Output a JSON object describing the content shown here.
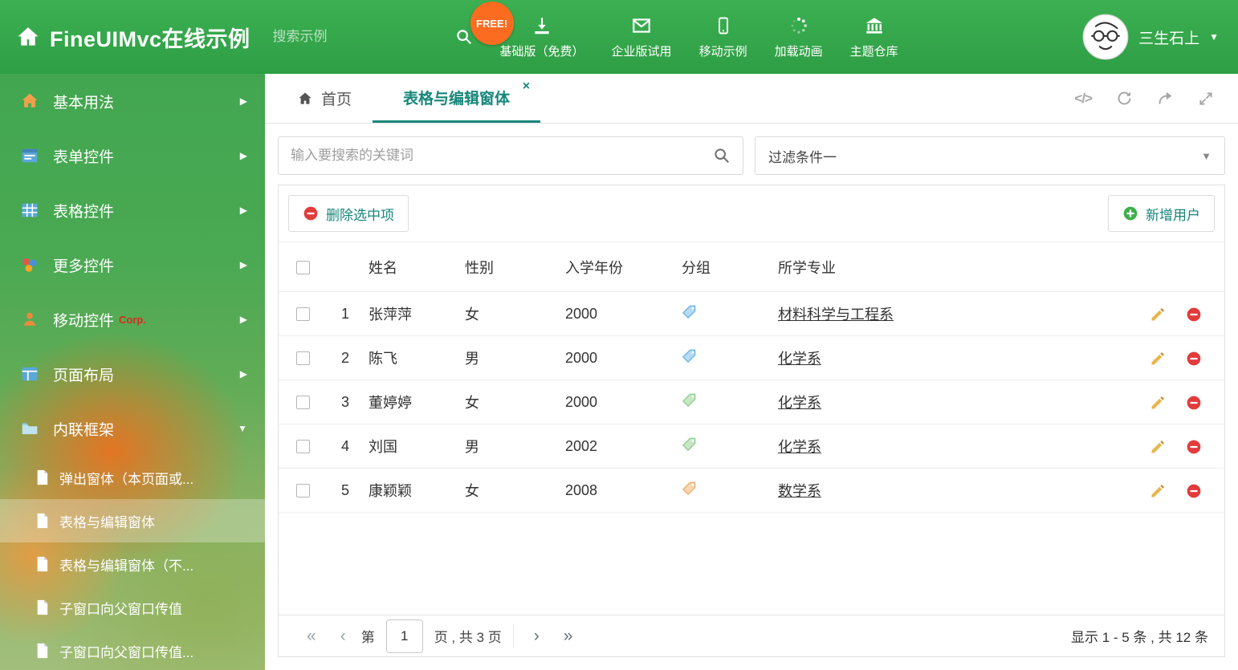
{
  "colors": {
    "header_green": "#35a94c",
    "accent_teal": "#17867a",
    "danger_red": "#e23b3b",
    "success_green": "#3daf4a",
    "free_badge_orange": "#fb6c20"
  },
  "icons": {
    "chevron_right": "▶",
    "chevron_down": "▼",
    "caret_down": "▼",
    "close": "×",
    "code": "</>",
    "pg_first": "«",
    "pg_prev": "‹",
    "pg_next": "›",
    "pg_last": "»"
  },
  "header": {
    "title": "FineUIMvc在线示例",
    "search_placeholder": "搜索示例",
    "free_badge": "FREE!",
    "nav": [
      {
        "label": "基础版（免费）",
        "icon": "download-icon"
      },
      {
        "label": "企业版试用",
        "icon": "envelope-icon"
      },
      {
        "label": "移动示例",
        "icon": "mobile-icon"
      },
      {
        "label": "加载动画",
        "icon": "loading-icon"
      },
      {
        "label": "主题仓库",
        "icon": "bank-icon"
      }
    ],
    "user_name": "三生石上"
  },
  "sidebar": {
    "items": [
      {
        "label": "基本用法",
        "icon": "home-icon"
      },
      {
        "label": "表单控件",
        "icon": "form-icon"
      },
      {
        "label": "表格控件",
        "icon": "table-icon"
      },
      {
        "label": "更多控件",
        "icon": "more-controls-icon"
      },
      {
        "label": "移动控件",
        "badge": "Corp.",
        "icon": "mobile-controls-icon"
      },
      {
        "label": "页面布局",
        "icon": "layout-icon"
      },
      {
        "label": "内联框架",
        "icon": "iframe-icon",
        "expanded": true
      }
    ],
    "subitems": [
      {
        "label": "弹出窗体（本页面或..."
      },
      {
        "label": "表格与编辑窗体",
        "active": true
      },
      {
        "label": "表格与编辑窗体（不..."
      },
      {
        "label": "子窗口向父窗口传值"
      },
      {
        "label": "子窗口向父窗口传值..."
      }
    ]
  },
  "tabs": {
    "home_label": "首页",
    "active_label": "表格与编辑窗体"
  },
  "filter": {
    "search_placeholder": "输入要搜索的关键词",
    "selected": "过滤条件一"
  },
  "toolbar": {
    "delete_label": "删除选中项",
    "add_label": "新增用户"
  },
  "table": {
    "columns": [
      "姓名",
      "性别",
      "入学年份",
      "分组",
      "所学专业"
    ],
    "rows": [
      {
        "num": "1",
        "name": "张萍萍",
        "gender": "女",
        "year": "2000",
        "tag_color": "#6fb7e8",
        "major": "材料科学与工程系"
      },
      {
        "num": "2",
        "name": "陈飞",
        "gender": "男",
        "year": "2000",
        "tag_color": "#6fb7e8",
        "major": "化学系"
      },
      {
        "num": "3",
        "name": "董婷婷",
        "gender": "女",
        "year": "2000",
        "tag_color": "#93cf90",
        "major": "化学系"
      },
      {
        "num": "4",
        "name": "刘国",
        "gender": "男",
        "year": "2002",
        "tag_color": "#93cf90",
        "major": "化学系"
      },
      {
        "num": "5",
        "name": "康颖颖",
        "gender": "女",
        "year": "2008",
        "tag_color": "#f2b06e",
        "major": "数学系"
      }
    ]
  },
  "pagination": {
    "label_page": "第",
    "current_page": "1",
    "label_total": "页 , 共 3 页",
    "summary": "显示 1 - 5 条 , 共 12 条"
  }
}
